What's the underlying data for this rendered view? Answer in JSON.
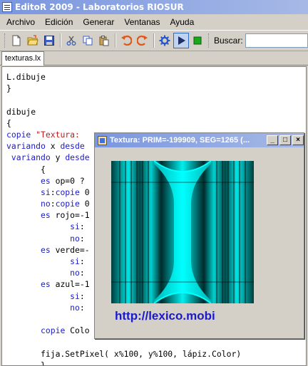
{
  "app": {
    "title": "EditoR 2009 - Laboratorios RIOSUR"
  },
  "menu": [
    {
      "label": "Archivo"
    },
    {
      "label": "Edición"
    },
    {
      "label": "Generar"
    },
    {
      "label": "Ventanas"
    },
    {
      "label": "Ayuda"
    }
  ],
  "toolbar": {
    "buttons": [
      {
        "icon": "new-file-icon"
      },
      {
        "icon": "open-folder-icon"
      },
      {
        "icon": "save-icon"
      },
      {
        "icon": "cut-icon"
      },
      {
        "icon": "copy-icon"
      },
      {
        "icon": "paste-icon"
      },
      {
        "icon": "undo-icon"
      },
      {
        "icon": "redo-icon"
      },
      {
        "icon": "settings-gear-icon"
      },
      {
        "icon": "run-play-icon"
      },
      {
        "icon": "stop-icon"
      }
    ],
    "search_label": "Buscar:",
    "search_value": ""
  },
  "tabs": [
    {
      "label": "texturas.lx",
      "active": true
    }
  ],
  "editor": {
    "lines": [
      "L.dibuje",
      "}",
      "",
      "dibuje",
      "{",
      "copie \"Textura:",
      "variando x desde",
      " variando y desde",
      "       {",
      "       es op=0 ?",
      "       si:copie 0",
      "       no:copie 0",
      "       es rojo=-1",
      "             si:",
      "             no:",
      "       es verde=-",
      "             si:",
      "             no:",
      "       es azul=-1",
      "             si:",
      "             no:",
      "",
      "       copie Colo",
      "",
      "       fija.SetPixel( x%100, y%100, lápiz.Color)",
      "       }"
    ]
  },
  "texture_window": {
    "title": "Textura: PRIM=-199909, SEG=1265 (...",
    "minimize": "_",
    "maximize": "□",
    "close": "×",
    "link": "http://lexico.mobi"
  },
  "colors": {
    "titlebar_start": "#7a96df",
    "titlebar_end": "#a6b9e6",
    "keyword": "#1a1acc",
    "string": "#c01a1a",
    "texture_cyan": "#00e5e5",
    "link": "#1a1acc"
  }
}
